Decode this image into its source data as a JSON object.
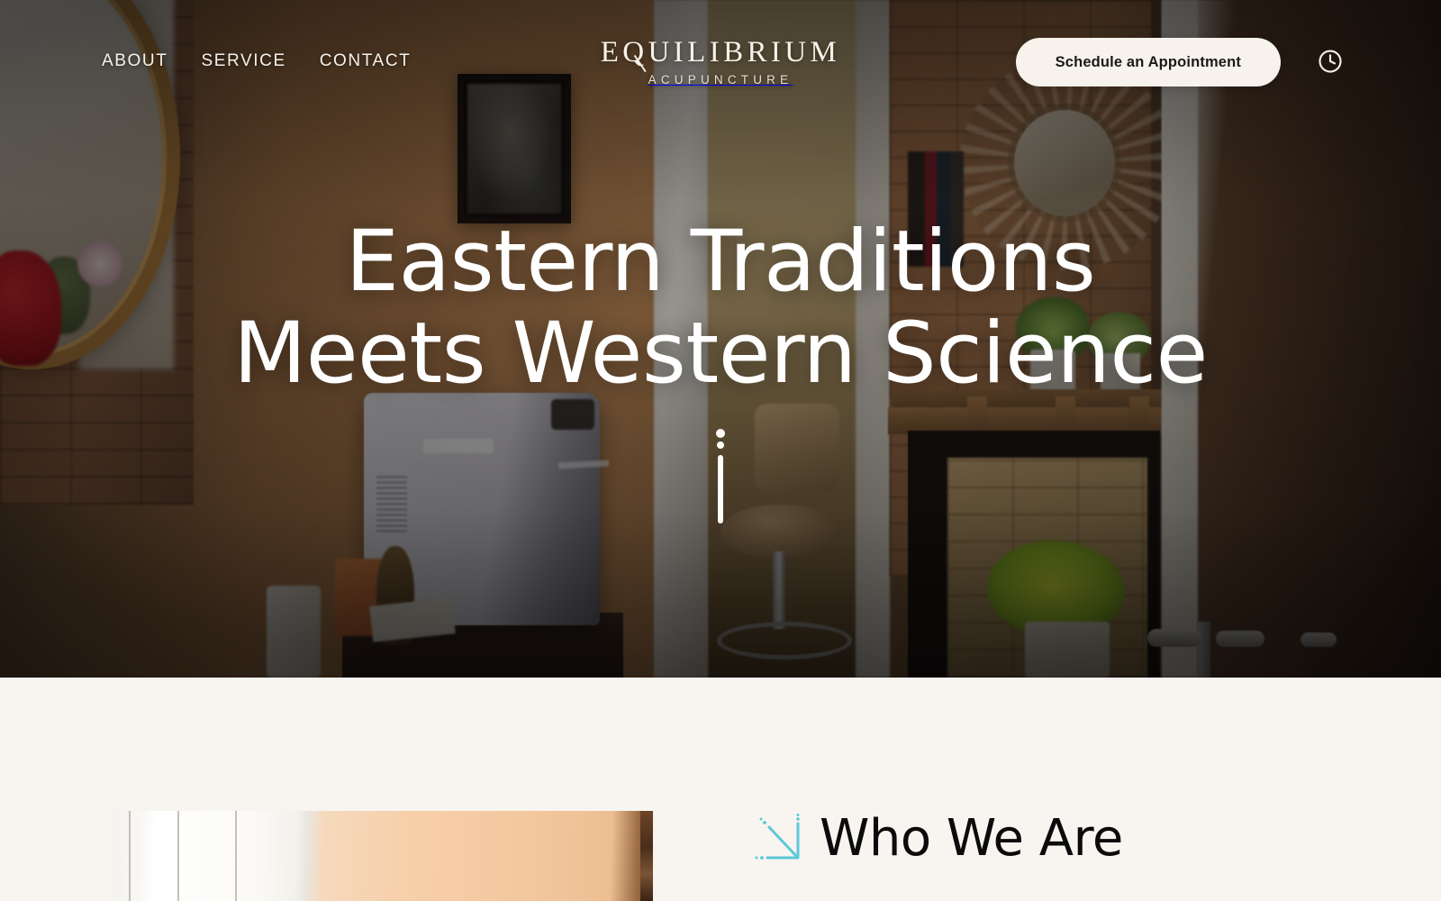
{
  "header": {
    "nav": [
      {
        "label": "ABOUT",
        "name": "nav-link-about"
      },
      {
        "label": "SERVICE",
        "name": "nav-link-service"
      },
      {
        "label": "CONTACT",
        "name": "nav-link-contact"
      }
    ],
    "logo": {
      "main": "EQUILIBRIUM",
      "sub": "ACUPUNCTURE"
    },
    "cta_label": "Schedule an Appointment",
    "clock_icon": "clock-icon"
  },
  "hero": {
    "headline_line1": "Eastern Traditions",
    "headline_line2": "Meets Western Science",
    "scroll_indicator": "needle-scroll-indicator"
  },
  "about_section": {
    "heading": "Who We Are",
    "heading_icon": "acupuncture-needle-icon"
  },
  "colors": {
    "cream_background": "#F8F5F1",
    "button_background": "#F7F3EC",
    "button_text": "#1A1A1A",
    "hero_text": "#FFFFFF",
    "nav_text": "#F6F1E9",
    "needle_accent": "#5CC8D8",
    "heading_text": "#0B0B0B"
  }
}
